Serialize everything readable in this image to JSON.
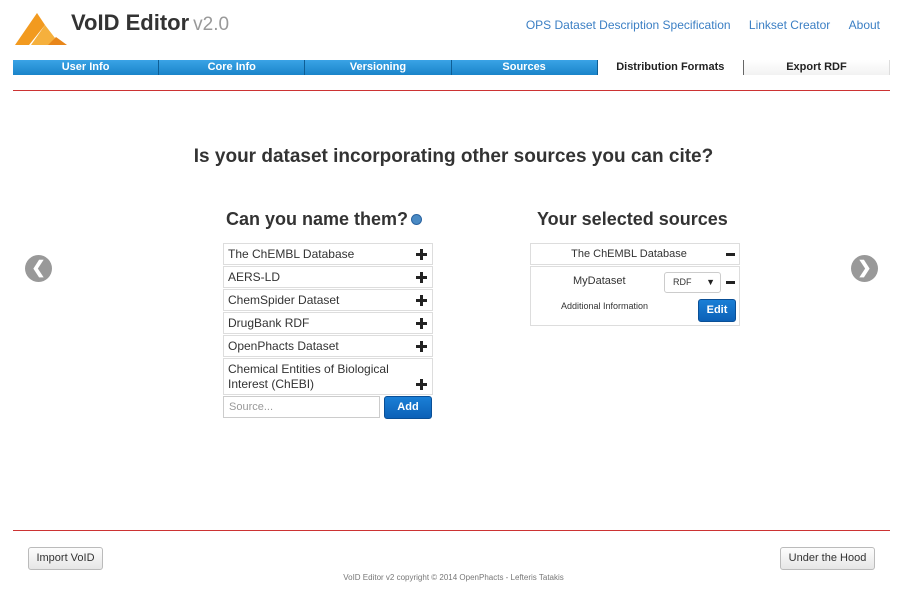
{
  "header": {
    "app_name": "VoID Editor",
    "version": "v2.0",
    "links": [
      "OPS Dataset Description Specification",
      "Linkset Creator",
      "About"
    ]
  },
  "tabs": [
    {
      "label": "User Info",
      "style": "completed"
    },
    {
      "label": "Core Info",
      "style": "completed"
    },
    {
      "label": "Versioning",
      "style": "completed"
    },
    {
      "label": "Sources",
      "style": "active"
    },
    {
      "label": "Distribution Formats",
      "style": "pending"
    },
    {
      "label": "Export RDF",
      "style": "pending"
    }
  ],
  "main": {
    "question": "Is your dataset incorporating other sources you can cite?",
    "left_title": "Can you name them?",
    "right_title": "Your selected sources",
    "sources": [
      "The ChEMBL Database",
      "AERS-LD",
      "ChemSpider Dataset",
      "DrugBank RDF",
      "OpenPhacts Dataset",
      "Chemical Entities of Biological Interest (ChEBI)"
    ],
    "source_input_placeholder": "Source...",
    "add_button": "Add",
    "selected": {
      "source_name": "The ChEMBL Database",
      "dataset_name": "MyDataset",
      "format_value": "RDF",
      "additional_info_label": "Additional Information",
      "edit_button": "Edit"
    },
    "prev_arrow": "❮",
    "next_arrow": "❯"
  },
  "footer": {
    "import_button": "Import VoID",
    "hood_button": "Under the Hood",
    "copyright": "VoID Editor v2 copyright © 2014 OpenPhacts - Lefteris Tatakis"
  },
  "colors": {
    "tab_blue": "#1a84c9",
    "accent_blue": "#0c61b7",
    "link_blue": "#3b7fc4",
    "divider_red": "#cc3333",
    "logo_orange": "#f29a1f"
  }
}
